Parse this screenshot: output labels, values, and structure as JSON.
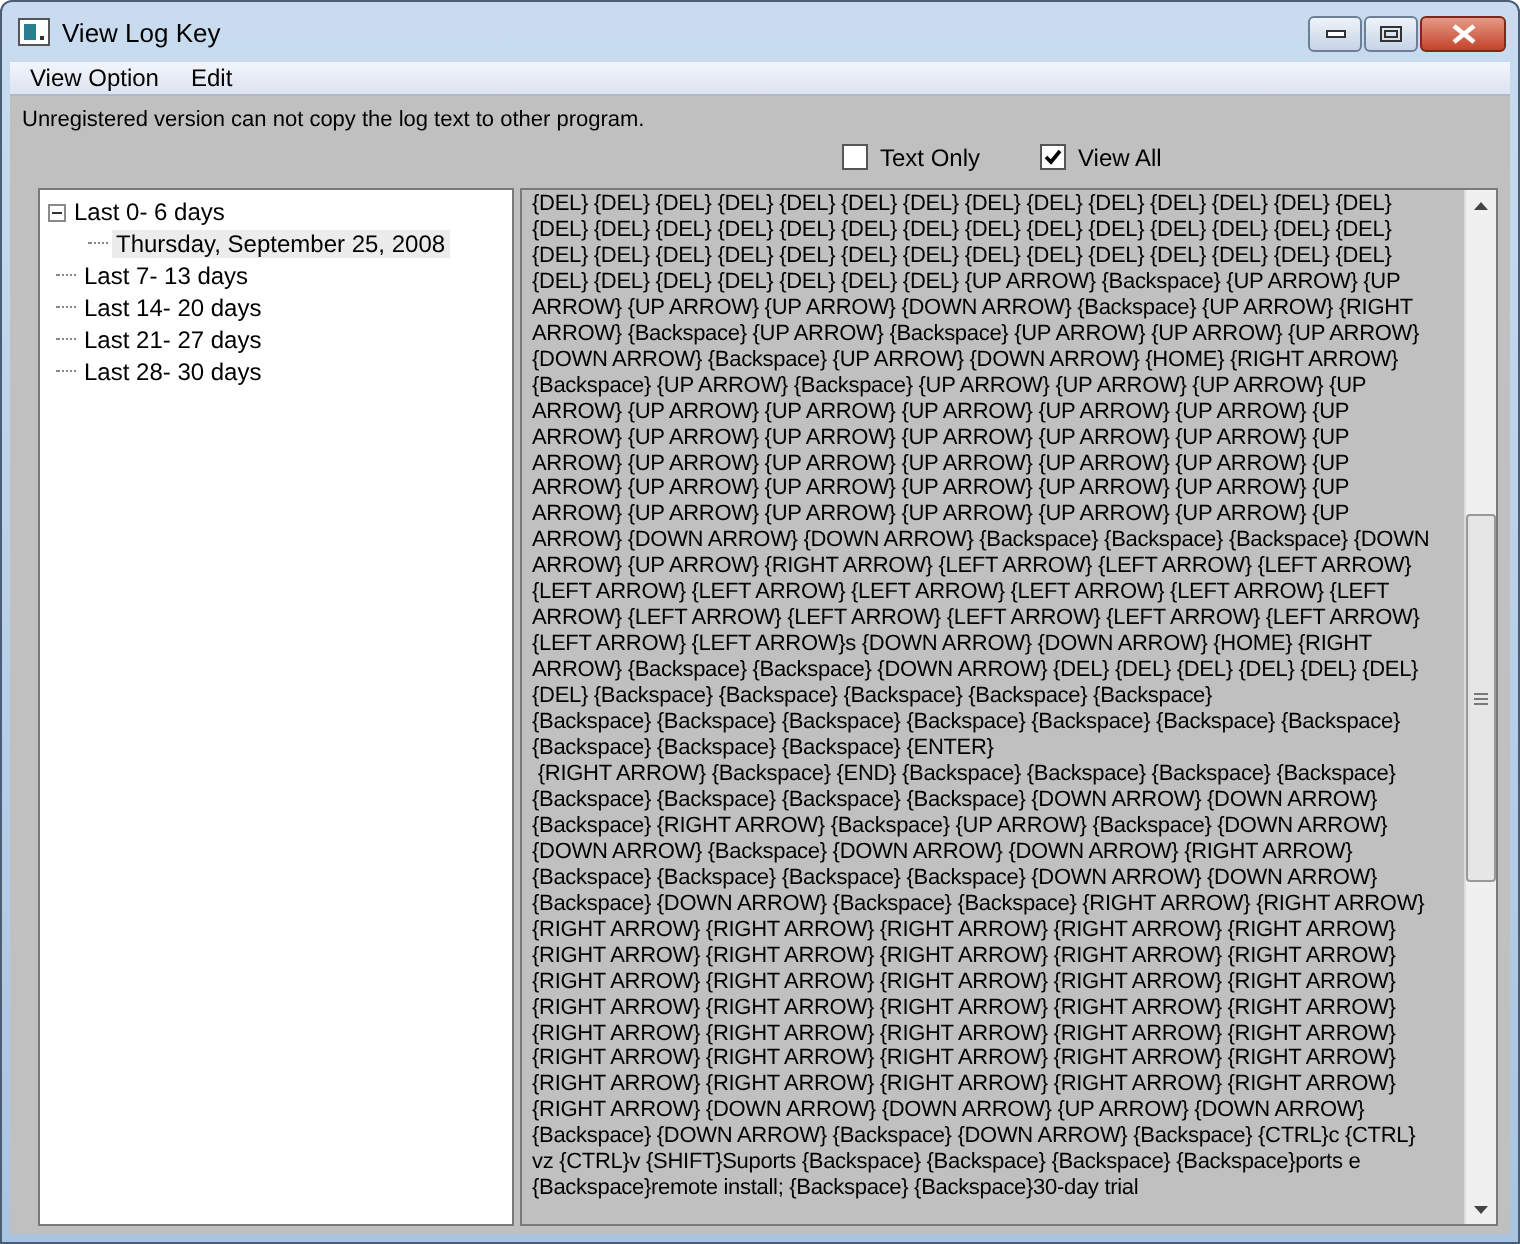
{
  "window": {
    "title": "View Log Key"
  },
  "menu": [
    "View Option",
    "Edit"
  ],
  "notice": "Unregistered version can not copy the log text to other program.",
  "options": [
    {
      "label": "Text Only",
      "checked": false
    },
    {
      "label": "View All",
      "checked": true
    }
  ],
  "tree": [
    {
      "label": "Last  0- 6 days",
      "expanded": true,
      "selected": false,
      "children": [
        {
          "label": "Thursday, September 25, 2008",
          "selected": true
        }
      ]
    },
    {
      "label": "Last  7- 13 days",
      "selected": false
    },
    {
      "label": "Last  14- 20 days",
      "selected": false
    },
    {
      "label": "Last  21- 27 days",
      "selected": false
    },
    {
      "label": "Last  28- 30 days",
      "selected": false
    }
  ],
  "log_lines": [
    "{DEL} {DEL} {DEL} {DEL} {DEL} {DEL} {DEL} {DEL} {DEL} {DEL} {DEL} {DEL} {DEL} {DEL}",
    "{DEL} {DEL} {DEL} {DEL} {DEL} {DEL} {DEL} {DEL} {DEL} {DEL} {DEL} {DEL} {DEL} {DEL}",
    "{DEL} {DEL} {DEL} {DEL} {DEL} {DEL} {DEL} {DEL} {DEL} {DEL} {DEL} {DEL} {DEL} {DEL}",
    "{DEL} {DEL} {DEL} {DEL} {DEL} {DEL} {DEL} {UP ARROW} {Backspace} {UP ARROW} {UP",
    "ARROW} {UP ARROW} {UP ARROW} {DOWN ARROW} {Backspace} {UP ARROW} {RIGHT",
    "ARROW} {Backspace} {UP ARROW} {Backspace} {UP ARROW} {UP ARROW} {UP ARROW}",
    "{DOWN ARROW} {Backspace} {UP ARROW} {DOWN ARROW} {HOME} {RIGHT ARROW}",
    "{Backspace} {UP ARROW} {Backspace} {UP ARROW} {UP ARROW} {UP ARROW} {UP",
    "ARROW} {UP ARROW} {UP ARROW} {UP ARROW} {UP ARROW} {UP ARROW} {UP",
    "ARROW} {UP ARROW} {UP ARROW} {UP ARROW} {UP ARROW} {UP ARROW} {UP",
    "ARROW} {UP ARROW} {UP ARROW} {UP ARROW} {UP ARROW} {UP ARROW} {UP",
    "ARROW} {UP ARROW} {UP ARROW} {UP ARROW} {UP ARROW} {UP ARROW} {UP",
    "ARROW} {UP ARROW} {UP ARROW} {UP ARROW} {UP ARROW} {UP ARROW} {UP",
    "ARROW} {DOWN ARROW} {DOWN ARROW} {Backspace} {Backspace} {Backspace} {DOWN",
    "ARROW} {UP ARROW} {RIGHT ARROW} {LEFT ARROW} {LEFT ARROW} {LEFT ARROW}",
    "{LEFT ARROW} {LEFT ARROW} {LEFT ARROW} {LEFT ARROW} {LEFT ARROW} {LEFT",
    "ARROW} {LEFT ARROW} {LEFT ARROW} {LEFT ARROW} {LEFT ARROW} {LEFT ARROW}",
    "{LEFT ARROW} {LEFT ARROW}s {DOWN ARROW} {DOWN ARROW} {HOME} {RIGHT",
    "ARROW} {Backspace} {Backspace} {DOWN ARROW} {DEL} {DEL} {DEL} {DEL} {DEL} {DEL}",
    "{DEL} {Backspace} {Backspace} {Backspace} {Backspace} {Backspace}",
    "{Backspace} {Backspace} {Backspace} {Backspace} {Backspace} {Backspace} {Backspace}",
    "{Backspace} {Backspace} {Backspace} {ENTER}",
    " {RIGHT ARROW} {Backspace} {END} {Backspace} {Backspace} {Backspace} {Backspace}",
    "{Backspace} {Backspace} {Backspace} {Backspace} {DOWN ARROW} {DOWN ARROW}",
    "{Backspace} {RIGHT ARROW} {Backspace} {UP ARROW} {Backspace} {DOWN ARROW}",
    "{DOWN ARROW} {Backspace} {DOWN ARROW} {DOWN ARROW} {RIGHT ARROW}",
    "{Backspace} {Backspace} {Backspace} {Backspace} {DOWN ARROW} {DOWN ARROW}",
    "{Backspace} {DOWN ARROW} {Backspace} {Backspace} {RIGHT ARROW} {RIGHT ARROW}",
    "{RIGHT ARROW} {RIGHT ARROW} {RIGHT ARROW} {RIGHT ARROW} {RIGHT ARROW}",
    "{RIGHT ARROW} {RIGHT ARROW} {RIGHT ARROW} {RIGHT ARROW} {RIGHT ARROW}",
    "{RIGHT ARROW} {RIGHT ARROW} {RIGHT ARROW} {RIGHT ARROW} {RIGHT ARROW}",
    "{RIGHT ARROW} {RIGHT ARROW} {RIGHT ARROW} {RIGHT ARROW} {RIGHT ARROW}",
    "{RIGHT ARROW} {RIGHT ARROW} {RIGHT ARROW} {RIGHT ARROW} {RIGHT ARROW}",
    "{RIGHT ARROW} {RIGHT ARROW} {RIGHT ARROW} {RIGHT ARROW} {RIGHT ARROW}",
    "{RIGHT ARROW} {RIGHT ARROW} {RIGHT ARROW} {RIGHT ARROW} {RIGHT ARROW}",
    "{RIGHT ARROW} {DOWN ARROW} {DOWN ARROW} {UP ARROW} {DOWN ARROW}",
    "{Backspace} {DOWN ARROW} {Backspace} {DOWN ARROW} {Backspace} {CTRL}c {CTRL}",
    "vz {CTRL}v {SHIFT}Suports {Backspace} {Backspace} {Backspace} {Backspace}ports e",
    "{Backspace}remote install; {Backspace} {Backspace}30-day trial"
  ]
}
